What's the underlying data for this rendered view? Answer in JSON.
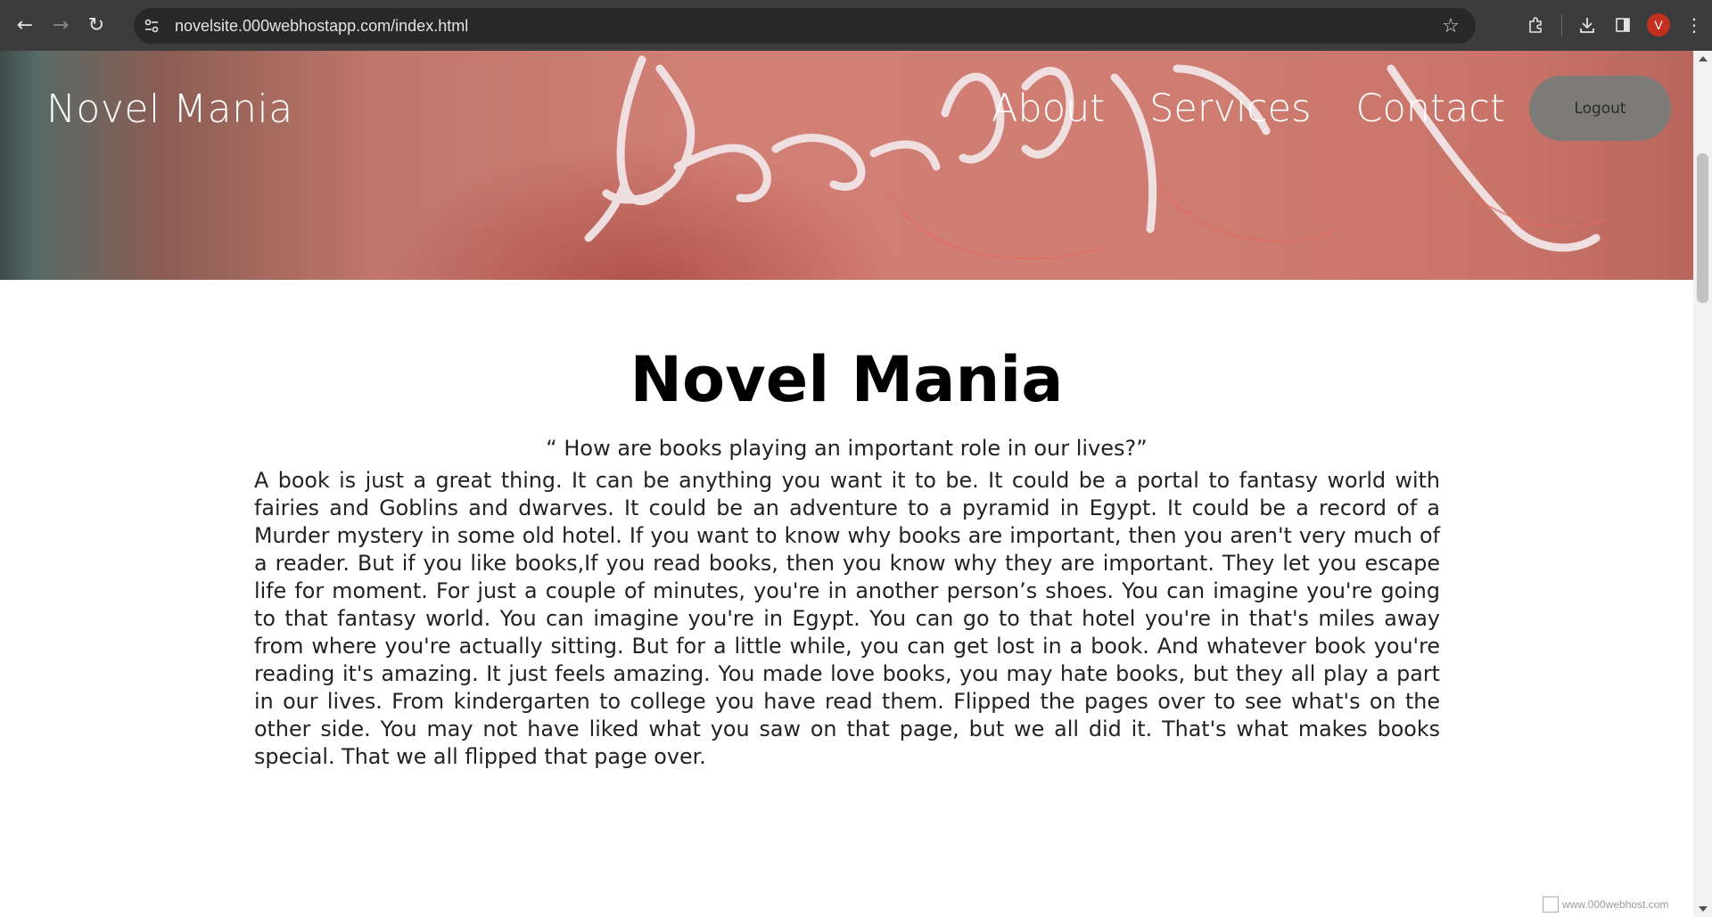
{
  "browser": {
    "url": "novelsite.000webhostapp.com/index.html",
    "profile_initial": "V",
    "icons": {
      "back": "back-arrow-icon",
      "forward": "forward-arrow-icon",
      "reload": "reload-icon",
      "site_info": "tune-icon",
      "bookmark": "star-icon",
      "extensions": "puzzle-icon",
      "downloads": "download-icon",
      "side_panel": "side-panel-icon",
      "menu": "more-vert-icon"
    },
    "accent_color": "#c2311e"
  },
  "header": {
    "logo": "Novel Mania",
    "nav": [
      {
        "label": "About"
      },
      {
        "label": "Services"
      },
      {
        "label": "Contact"
      }
    ],
    "logout_label": "Logout"
  },
  "content": {
    "title": "Novel Mania",
    "quote": "“ How are books playing an important role in our lives?”",
    "paragraph": "A book is just a great thing. It can be anything you want it to be. It could be a portal to fantasy world with fairies and Goblins and dwarves. It could be an adventure to a pyramid in Egypt. It could be a record of a Murder mystery in some old hotel. If you want to know why books are important, then you aren't very much of a reader. But if you like books,If you read books, then you know why they are important. They let you escape life for moment. For just a couple of minutes, you're in another person’s shoes. You can imagine you're going to that fantasy world. You can imagine you're in Egypt. You can go to that hotel you're in that's miles away from where you're actually sitting. But for a little while, you can get lost in a book. And whatever book you're reading it's amazing. It just feels amazing. You made love books, you may hate books, but they all play a part in our lives. From kindergarten to college you have read them. Flipped the pages over to see what's on the other side. You may not have liked what you saw on that page, but we all did it. That's what makes books special. That we all flipped that page over."
  },
  "footer_badge": "www.000webhost.com"
}
